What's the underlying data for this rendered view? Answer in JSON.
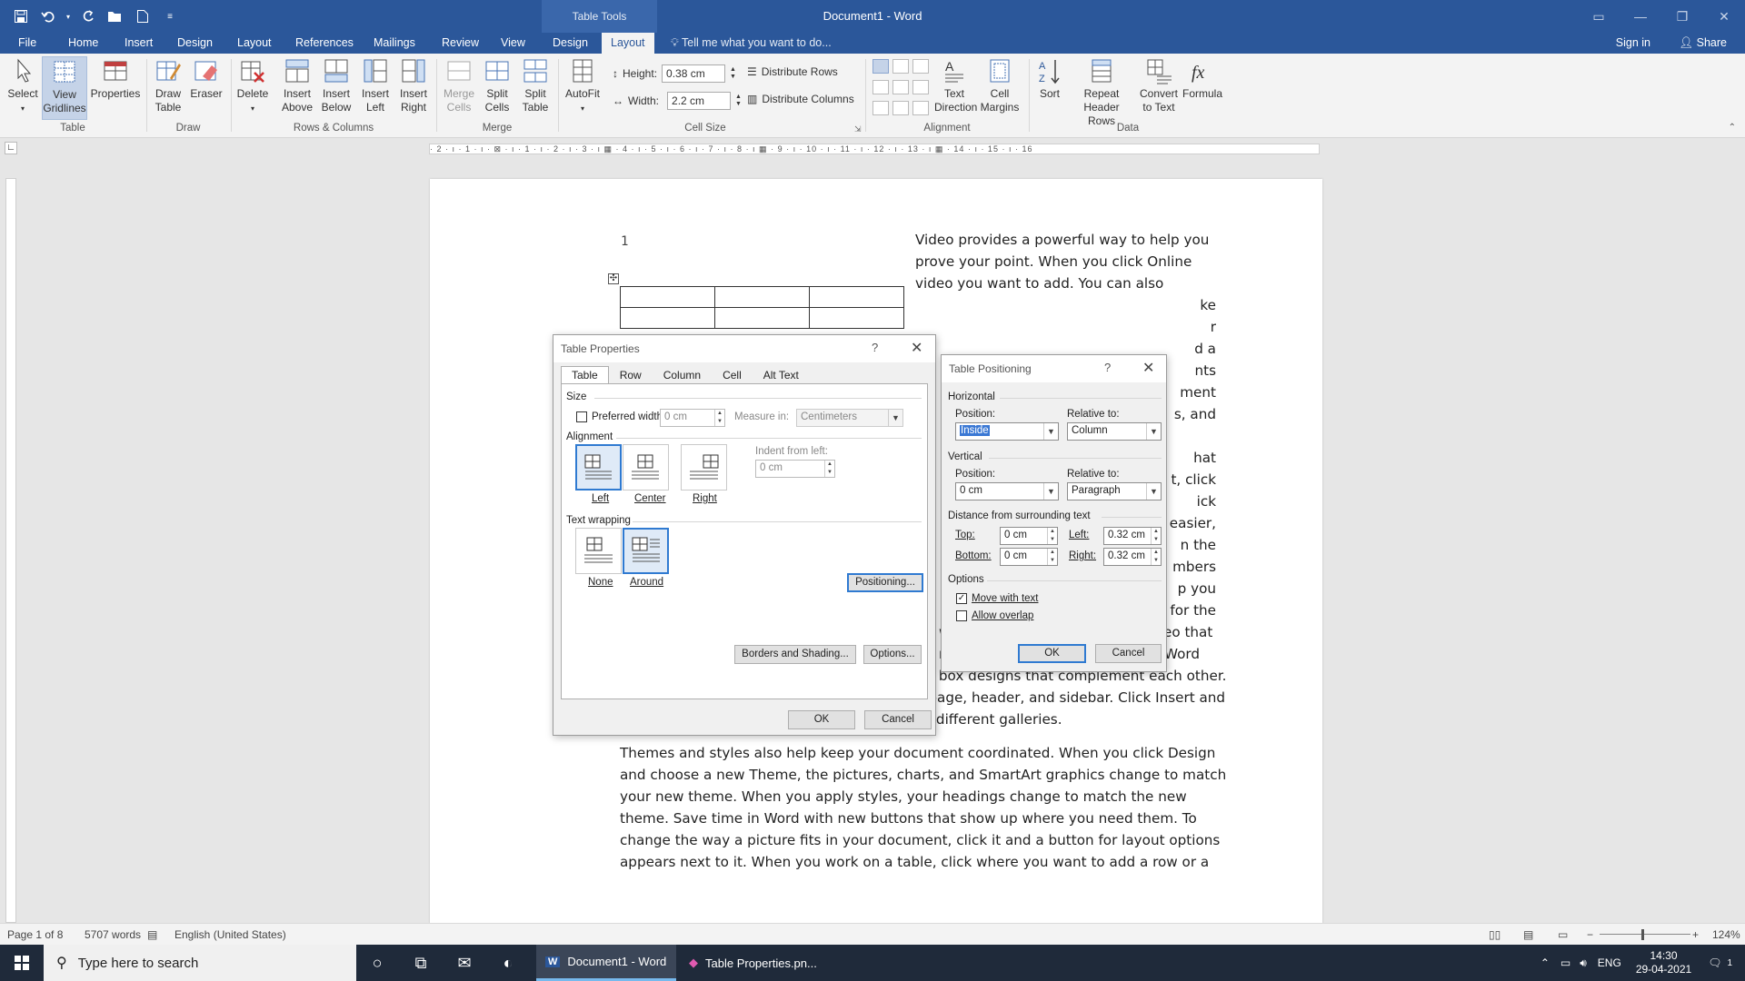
{
  "app": {
    "doc_title": "Document1  -  Word",
    "context_tab_group": "Table Tools"
  },
  "quick_access": [
    "save-icon",
    "undo-icon",
    "redo-icon",
    "open-icon",
    "new-icon",
    "customize-icon"
  ],
  "ribbon_tabs": [
    "File",
    "Home",
    "Insert",
    "Design",
    "Layout",
    "References",
    "Mailings",
    "Review",
    "View",
    "Design",
    "Layout"
  ],
  "active_tab_index": 10,
  "tell_me": "Tell me what you want to do...",
  "sign_in": "Sign in",
  "share": "Share",
  "ribbon": {
    "table": {
      "group": "Table",
      "select": "Select",
      "view_gridlines": [
        "View",
        "Gridlines"
      ],
      "properties": "Properties"
    },
    "draw": {
      "group": "Draw",
      "draw_table": [
        "Draw",
        "Table"
      ],
      "eraser": "Eraser"
    },
    "rows_columns": {
      "group": "Rows & Columns",
      "delete": "Delete",
      "insert_above": [
        "Insert",
        "Above"
      ],
      "insert_below": [
        "Insert",
        "Below"
      ],
      "insert_left": [
        "Insert",
        "Left"
      ],
      "insert_right": [
        "Insert",
        "Right"
      ]
    },
    "merge": {
      "group": "Merge",
      "merge_cells": [
        "Merge",
        "Cells"
      ],
      "split_cells": [
        "Split",
        "Cells"
      ],
      "split_table": [
        "Split",
        "Table"
      ]
    },
    "cell_size": {
      "group": "Cell Size",
      "autofit": "AutoFit",
      "height_label": "Height:",
      "height_value": "0.38 cm",
      "width_label": "Width:",
      "width_value": "2.2 cm",
      "distribute_rows": "Distribute Rows",
      "distribute_columns": "Distribute Columns"
    },
    "alignment": {
      "group": "Alignment",
      "text_direction": [
        "Text",
        "Direction"
      ],
      "cell_margins": [
        "Cell",
        "Margins"
      ]
    },
    "data": {
      "group": "Data",
      "sort": "Sort",
      "repeat_header_rows": [
        "Repeat",
        "Header Rows"
      ],
      "convert_to_text": [
        "Convert",
        "to Text"
      ],
      "formula": "Formula"
    }
  },
  "ruler_text": "· 2 · ı · 1 · ı · ⊠ · ı · 1 · ı · 2 · ı · 3 · ı ▦ · 4 · ı · 5 · ı · 6 · ı · 7 · ı · 8 · ı ▦ · 9 · ı · 10 · ı · 11 · ı · 12 · ı · 13 · ı ▦ · 14 · ı · 15 · ı · 16",
  "document": {
    "page_number": "1",
    "right_column_lines": [
      "Video provides a powerful way to help you",
      "prove your point. When you click Online",
      "video you want to add. You can also",
      "ke",
      "r",
      "d a",
      "nts",
      "ment",
      "s, and",
      "",
      "hat",
      "t, click",
      "ick",
      "easier,",
      "n the",
      "mbers",
      "p you",
      "for the",
      "word to search online for the video that",
      "nt look professionally produced, Word"
    ],
    "full_lines_para1_tail": [
      "provides header, footer, cover page, and text box designs that complement each other.",
      "For example, you can add a matching cover page, header, and sidebar. Click Insert and",
      "then choose the elements you want from the different galleries."
    ],
    "para2_lines": [
      "Themes and styles also help keep your document coordinated. When you click Design",
      "and choose a new Theme, the pictures, charts, and SmartArt graphics change to match",
      "your new theme. When you apply styles, your headings change to match the new",
      "theme. Save time in Word with new buttons that show up where you need them. To",
      "change the way a picture fits in your document, click it and a button for layout options",
      "appears next to it. When you work on a table, click where you want to add a row or a"
    ]
  },
  "table_properties": {
    "title": "Table Properties",
    "help": "?",
    "tabs": [
      "Table",
      "Row",
      "Column",
      "Cell",
      "Alt Text"
    ],
    "size_label": "Size",
    "preferred_width_label": "Preferred width:",
    "preferred_width_checked": false,
    "preferred_width_value": "0 cm",
    "measure_in_label": "Measure in:",
    "measure_in_value": "Centimeters",
    "alignment_label": "Alignment",
    "alignment_options": [
      "Left",
      "Center",
      "Right"
    ],
    "alignment_selected": "Left",
    "indent_label": "Indent from left:",
    "indent_value": "0 cm",
    "wrapping_label": "Text wrapping",
    "wrapping_options": [
      "None",
      "Around"
    ],
    "wrapping_selected": "Around",
    "positioning_button": "Positioning...",
    "borders_button": "Borders and Shading...",
    "options_button": "Options...",
    "ok": "OK",
    "cancel": "Cancel"
  },
  "table_positioning": {
    "title": "Table Positioning",
    "help": "?",
    "horizontal_label": "Horizontal",
    "h_position_label": "Position:",
    "h_position_value": "Inside",
    "h_relative_label": "Relative to:",
    "h_relative_value": "Column",
    "vertical_label": "Vertical",
    "v_position_label": "Position:",
    "v_position_value": "0 cm",
    "v_relative_label": "Relative to:",
    "v_relative_value": "Paragraph",
    "distance_label": "Distance from surrounding text",
    "top_label": "Top:",
    "top_value": "0 cm",
    "bottom_label": "Bottom:",
    "bottom_value": "0 cm",
    "left_label": "Left:",
    "left_value": "0.32 cm",
    "right_label": "Right:",
    "right_value": "0.32 cm",
    "options_label": "Options",
    "move_with_text": "Move with text",
    "move_with_text_checked": true,
    "allow_overlap": "Allow overlap",
    "allow_overlap_checked": false,
    "ok": "OK",
    "cancel": "Cancel"
  },
  "status": {
    "page": "Page 1 of 8",
    "words": "5707 words",
    "language": "English (United States)",
    "zoom": "124%"
  },
  "taskbar": {
    "search_placeholder": "Type here to search",
    "apps": [
      "Document1 - Word",
      "Table Properties.pn..."
    ],
    "lang": "ENG",
    "time": "14:30",
    "date": "29-04-2021",
    "notifications": "1"
  },
  "colors": {
    "word_blue": "#2b579a",
    "ribbon_bg": "#f3f3f3",
    "dialog_bg": "#f0f0f0",
    "accent_blue": "#2f7ad1"
  }
}
